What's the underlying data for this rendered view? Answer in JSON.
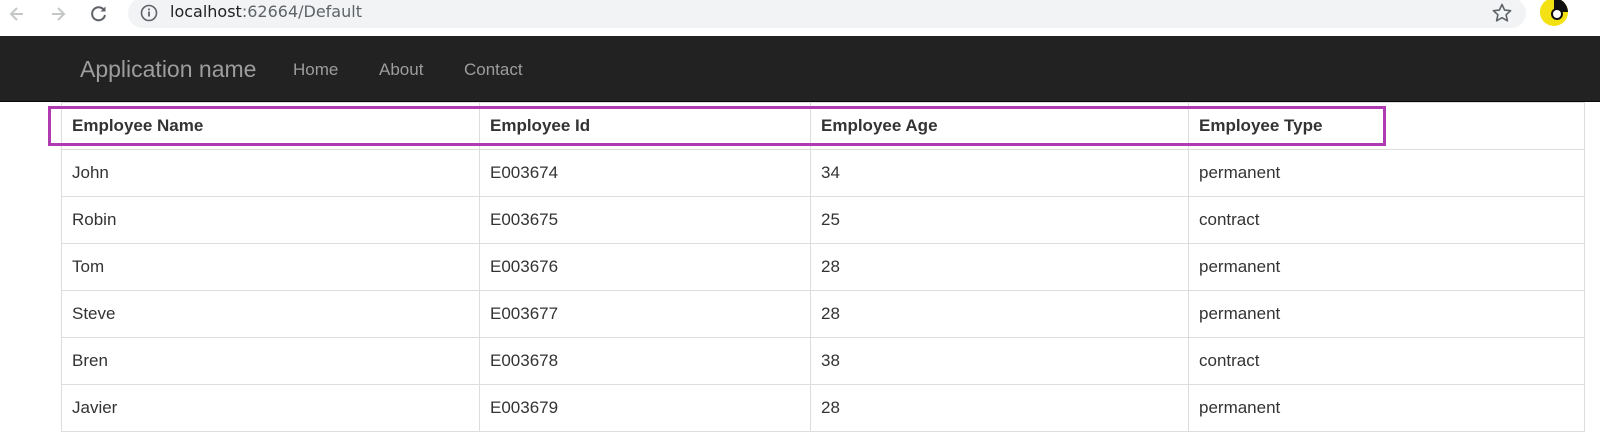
{
  "browser": {
    "url_host": "localhost",
    "url_rest": ":62664/Default",
    "icons": [
      "back-arrow-icon",
      "forward-arrow-icon",
      "reload-icon",
      "info-icon",
      "star-icon",
      "profile-avatar"
    ]
  },
  "navbar": {
    "brand": "Application name",
    "links": [
      {
        "label": "Home"
      },
      {
        "label": "About"
      },
      {
        "label": "Contact"
      }
    ]
  },
  "table": {
    "columns": [
      "Employee Name",
      "Employee Id",
      "Employee Age",
      "Employee Type"
    ],
    "rows": [
      [
        "John",
        "E003674",
        "34",
        "permanent"
      ],
      [
        "Robin",
        "E003675",
        "25",
        "contract"
      ],
      [
        "Tom",
        "E003676",
        "28",
        "permanent"
      ],
      [
        "Steve",
        "E003677",
        "28",
        "permanent"
      ],
      [
        "Bren",
        "E003678",
        "38",
        "contract"
      ],
      [
        "Javier",
        "E003679",
        "28",
        "permanent"
      ]
    ]
  },
  "colors": {
    "navbar_bg": "#222222",
    "nav_text": "#9d9d9d",
    "highlight": "#b03ab0",
    "table_border": "#dddddd"
  }
}
